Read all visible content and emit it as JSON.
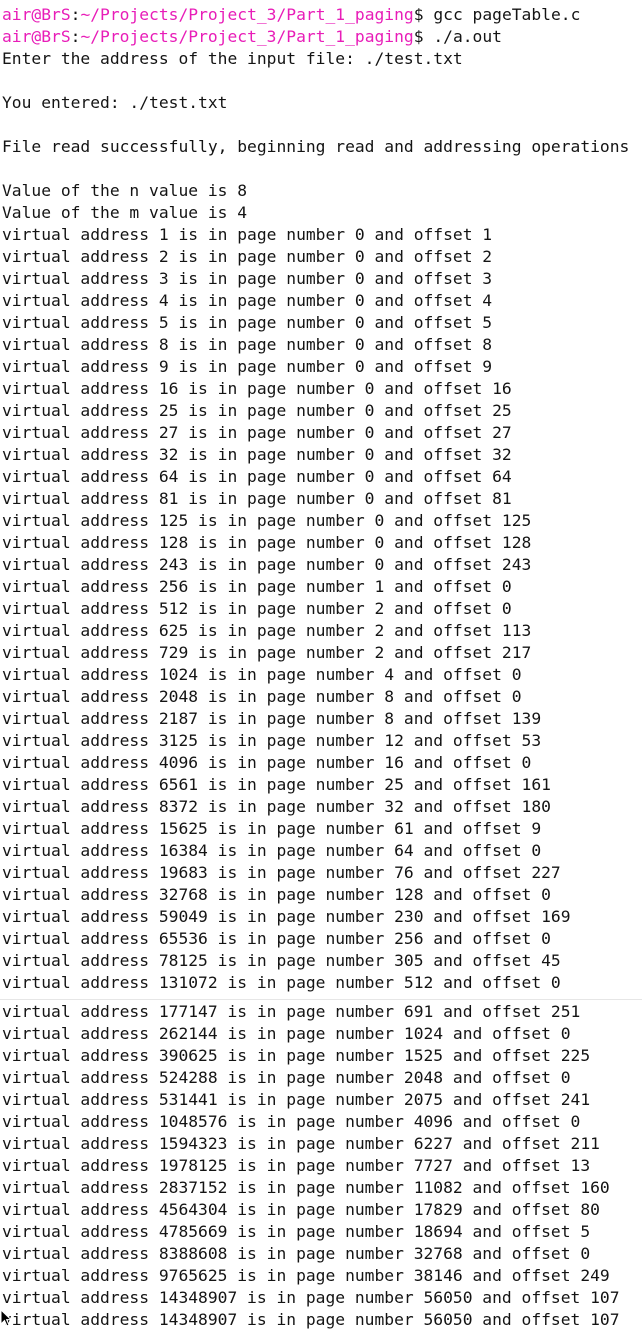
{
  "colors": {
    "prompt": "#e81db8",
    "text": "#141414",
    "background": "#ffffff"
  },
  "prompts": [
    {
      "user": "air@BrS",
      "sep": ":",
      "path": "~/Projects/Project_3/Part_1_paging",
      "sym": "$",
      "command": " gcc pageTable.c"
    },
    {
      "user": "air@BrS",
      "sep": ":",
      "path": "~/Projects/Project_3/Part_1_paging",
      "sym": "$",
      "command": " ./a.out"
    }
  ],
  "output_top": [
    "Enter the address of the input file: ./test.txt",
    "",
    "You entered: ./test.txt",
    "",
    "File read successfully, beginning read and addressing operations",
    "",
    "Value of the n value is 8",
    "Value of the m value is 4",
    "virtual address 1 is in page number 0 and offset 1",
    "virtual address 2 is in page number 0 and offset 2",
    "virtual address 3 is in page number 0 and offset 3",
    "virtual address 4 is in page number 0 and offset 4",
    "virtual address 5 is in page number 0 and offset 5",
    "virtual address 8 is in page number 0 and offset 8",
    "virtual address 9 is in page number 0 and offset 9",
    "virtual address 16 is in page number 0 and offset 16",
    "virtual address 25 is in page number 0 and offset 25",
    "virtual address 27 is in page number 0 and offset 27",
    "virtual address 32 is in page number 0 and offset 32",
    "virtual address 64 is in page number 0 and offset 64",
    "virtual address 81 is in page number 0 and offset 81",
    "virtual address 125 is in page number 0 and offset 125",
    "virtual address 128 is in page number 0 and offset 128",
    "virtual address 243 is in page number 0 and offset 243",
    "virtual address 256 is in page number 1 and offset 0",
    "virtual address 512 is in page number 2 and offset 0",
    "virtual address 625 is in page number 2 and offset 113",
    "virtual address 729 is in page number 2 and offset 217",
    "virtual address 1024 is in page number 4 and offset 0",
    "virtual address 2048 is in page number 8 and offset 0",
    "virtual address 2187 is in page number 8 and offset 139",
    "virtual address 3125 is in page number 12 and offset 53",
    "virtual address 4096 is in page number 16 and offset 0",
    "virtual address 6561 is in page number 25 and offset 161",
    "virtual address 8372 is in page number 32 and offset 180",
    "virtual address 15625 is in page number 61 and offset 9",
    "virtual address 16384 is in page number 64 and offset 0",
    "virtual address 19683 is in page number 76 and offset 227",
    "virtual address 32768 is in page number 128 and offset 0",
    "virtual address 59049 is in page number 230 and offset 169",
    "virtual address 65536 is in page number 256 and offset 0",
    "virtual address 78125 is in page number 305 and offset 45",
    "virtual address 131072 is in page number 512 and offset 0"
  ],
  "output_bottom": [
    "virtual address 177147 is in page number 691 and offset 251",
    "virtual address 262144 is in page number 1024 and offset 0",
    "virtual address 390625 is in page number 1525 and offset 225",
    "virtual address 524288 is in page number 2048 and offset 0",
    "virtual address 531441 is in page number 2075 and offset 241",
    "virtual address 1048576 is in page number 4096 and offset 0",
    "virtual address 1594323 is in page number 6227 and offset 211",
    "virtual address 1978125 is in page number 7727 and offset 13",
    "virtual address 2837152 is in page number 11082 and offset 160",
    "virtual address 4564304 is in page number 17829 and offset 80",
    "virtual address 4785669 is in page number 18694 and offset 5",
    "virtual address 8388608 is in page number 32768 and offset 0",
    "virtual address 9765625 is in page number 38146 and offset 249",
    "virtual address 14348907 is in page number 56050 and offset 107",
    "virtual address 14348907 is in page number 56050 and offset 107"
  ]
}
